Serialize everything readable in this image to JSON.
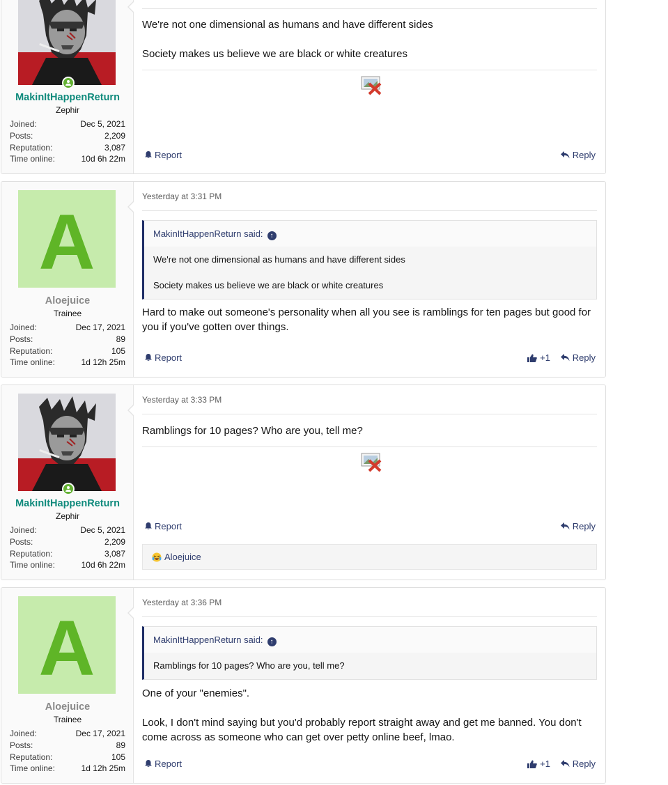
{
  "labels": {
    "joined": "Joined:",
    "posts": "Posts:",
    "reputation": "Reputation:",
    "time_online": "Time online:",
    "report": "Report",
    "reply": "Reply",
    "said_suffix": "said:"
  },
  "users": {
    "makin": {
      "name": "MakinItHappenReturn",
      "title": "Zephir",
      "joined": "Dec 5, 2021",
      "posts": "2,209",
      "reputation": "3,087",
      "time_online": "10d 6h 22m"
    },
    "aloe": {
      "name": "Aloejuice",
      "avatar_letter": "A",
      "title": "Trainee",
      "joined": "Dec 17, 2021",
      "posts": "89",
      "reputation": "105",
      "time_online": "1d 12h 25m"
    }
  },
  "posts": [
    {
      "lines": [
        "We're not one dimensional as humans and have different sides",
        "Society makes us believe we are black or white creatures"
      ]
    },
    {
      "date": "Yesterday at 3:31 PM",
      "quote_author": "MakinItHappenReturn said:",
      "quote_lines": [
        "We're not one dimensional as humans and have different sides",
        "Society makes us believe we are black or white creatures"
      ],
      "body": "Hard to make out someone's personality when all you see is ramblings for ten pages but good for you if you've gotten over things.",
      "likes": "+1"
    },
    {
      "date": "Yesterday at 3:33 PM",
      "body": "Ramblings for 10 pages? Who are you, tell me?",
      "reaction_user": "Aloejuice"
    },
    {
      "date": "Yesterday at 3:36 PM",
      "quote_author": "MakinItHappenReturn said:",
      "quote_lines": [
        "Ramblings for 10 pages? Who are you, tell me?"
      ],
      "body_lines": [
        "One of your \"enemies\".",
        "Look, I don't mind saying but you'd probably report straight away and get me banned. You don't come across as someone who can get over petty online beef, lmao."
      ],
      "likes": "+1"
    }
  ],
  "icons": {
    "report": "bell-icon",
    "reply": "reply-arrow-icon",
    "like": "thumbs-up-icon",
    "quote_jump": "arrow-up-circle-icon",
    "reaction": "laughing-crying-emoji-icon",
    "broken_image": "broken-image-icon"
  },
  "colors": {
    "username_active": "#0f8a7c",
    "username_muted": "#8a8a8a",
    "link": "#2f3d6e",
    "avatar_bg": "#c6ebac",
    "avatar_letter": "#5fb527",
    "online": "#63b032"
  }
}
